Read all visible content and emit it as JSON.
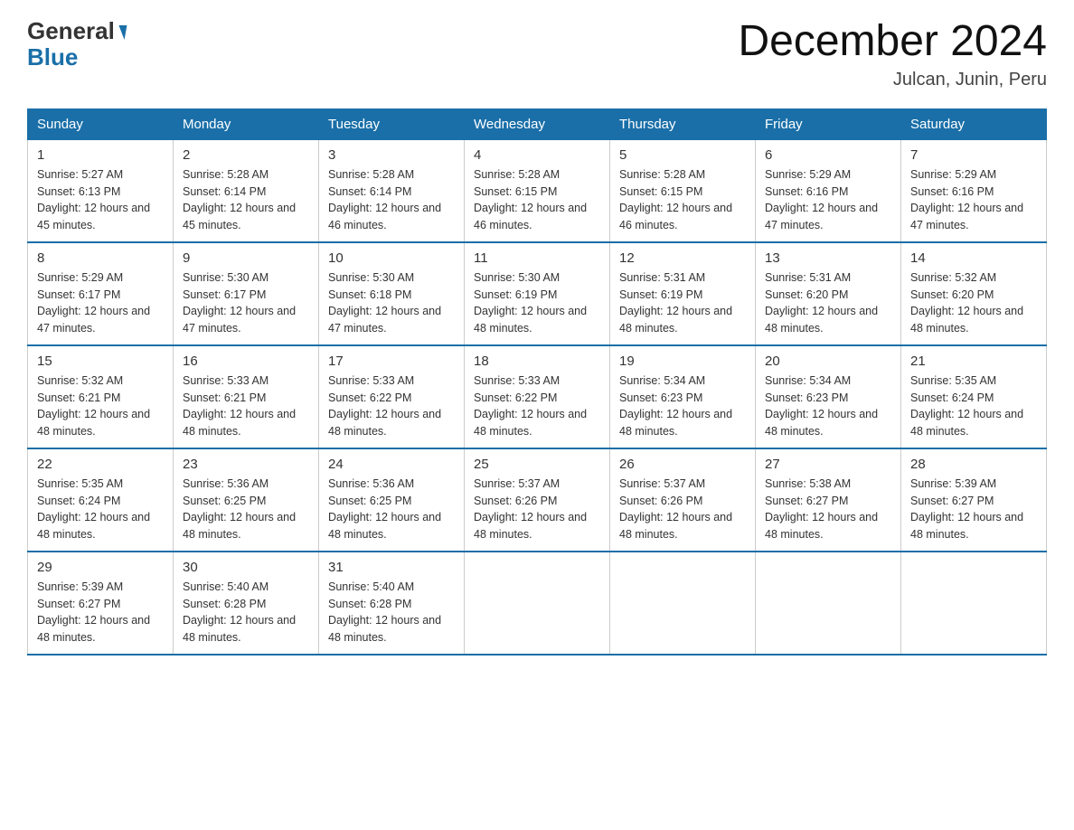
{
  "header": {
    "title": "December 2024",
    "location": "Julcan, Junin, Peru",
    "logo_line1": "General",
    "logo_line2": "Blue"
  },
  "days_of_week": [
    "Sunday",
    "Monday",
    "Tuesday",
    "Wednesday",
    "Thursday",
    "Friday",
    "Saturday"
  ],
  "weeks": [
    [
      {
        "day": "1",
        "sunrise": "5:27 AM",
        "sunset": "6:13 PM",
        "daylight": "12 hours and 45 minutes."
      },
      {
        "day": "2",
        "sunrise": "5:28 AM",
        "sunset": "6:14 PM",
        "daylight": "12 hours and 45 minutes."
      },
      {
        "day": "3",
        "sunrise": "5:28 AM",
        "sunset": "6:14 PM",
        "daylight": "12 hours and 46 minutes."
      },
      {
        "day": "4",
        "sunrise": "5:28 AM",
        "sunset": "6:15 PM",
        "daylight": "12 hours and 46 minutes."
      },
      {
        "day": "5",
        "sunrise": "5:28 AM",
        "sunset": "6:15 PM",
        "daylight": "12 hours and 46 minutes."
      },
      {
        "day": "6",
        "sunrise": "5:29 AM",
        "sunset": "6:16 PM",
        "daylight": "12 hours and 47 minutes."
      },
      {
        "day": "7",
        "sunrise": "5:29 AM",
        "sunset": "6:16 PM",
        "daylight": "12 hours and 47 minutes."
      }
    ],
    [
      {
        "day": "8",
        "sunrise": "5:29 AM",
        "sunset": "6:17 PM",
        "daylight": "12 hours and 47 minutes."
      },
      {
        "day": "9",
        "sunrise": "5:30 AM",
        "sunset": "6:17 PM",
        "daylight": "12 hours and 47 minutes."
      },
      {
        "day": "10",
        "sunrise": "5:30 AM",
        "sunset": "6:18 PM",
        "daylight": "12 hours and 47 minutes."
      },
      {
        "day": "11",
        "sunrise": "5:30 AM",
        "sunset": "6:19 PM",
        "daylight": "12 hours and 48 minutes."
      },
      {
        "day": "12",
        "sunrise": "5:31 AM",
        "sunset": "6:19 PM",
        "daylight": "12 hours and 48 minutes."
      },
      {
        "day": "13",
        "sunrise": "5:31 AM",
        "sunset": "6:20 PM",
        "daylight": "12 hours and 48 minutes."
      },
      {
        "day": "14",
        "sunrise": "5:32 AM",
        "sunset": "6:20 PM",
        "daylight": "12 hours and 48 minutes."
      }
    ],
    [
      {
        "day": "15",
        "sunrise": "5:32 AM",
        "sunset": "6:21 PM",
        "daylight": "12 hours and 48 minutes."
      },
      {
        "day": "16",
        "sunrise": "5:33 AM",
        "sunset": "6:21 PM",
        "daylight": "12 hours and 48 minutes."
      },
      {
        "day": "17",
        "sunrise": "5:33 AM",
        "sunset": "6:22 PM",
        "daylight": "12 hours and 48 minutes."
      },
      {
        "day": "18",
        "sunrise": "5:33 AM",
        "sunset": "6:22 PM",
        "daylight": "12 hours and 48 minutes."
      },
      {
        "day": "19",
        "sunrise": "5:34 AM",
        "sunset": "6:23 PM",
        "daylight": "12 hours and 48 minutes."
      },
      {
        "day": "20",
        "sunrise": "5:34 AM",
        "sunset": "6:23 PM",
        "daylight": "12 hours and 48 minutes."
      },
      {
        "day": "21",
        "sunrise": "5:35 AM",
        "sunset": "6:24 PM",
        "daylight": "12 hours and 48 minutes."
      }
    ],
    [
      {
        "day": "22",
        "sunrise": "5:35 AM",
        "sunset": "6:24 PM",
        "daylight": "12 hours and 48 minutes."
      },
      {
        "day": "23",
        "sunrise": "5:36 AM",
        "sunset": "6:25 PM",
        "daylight": "12 hours and 48 minutes."
      },
      {
        "day": "24",
        "sunrise": "5:36 AM",
        "sunset": "6:25 PM",
        "daylight": "12 hours and 48 minutes."
      },
      {
        "day": "25",
        "sunrise": "5:37 AM",
        "sunset": "6:26 PM",
        "daylight": "12 hours and 48 minutes."
      },
      {
        "day": "26",
        "sunrise": "5:37 AM",
        "sunset": "6:26 PM",
        "daylight": "12 hours and 48 minutes."
      },
      {
        "day": "27",
        "sunrise": "5:38 AM",
        "sunset": "6:27 PM",
        "daylight": "12 hours and 48 minutes."
      },
      {
        "day": "28",
        "sunrise": "5:39 AM",
        "sunset": "6:27 PM",
        "daylight": "12 hours and 48 minutes."
      }
    ],
    [
      {
        "day": "29",
        "sunrise": "5:39 AM",
        "sunset": "6:27 PM",
        "daylight": "12 hours and 48 minutes."
      },
      {
        "day": "30",
        "sunrise": "5:40 AM",
        "sunset": "6:28 PM",
        "daylight": "12 hours and 48 minutes."
      },
      {
        "day": "31",
        "sunrise": "5:40 AM",
        "sunset": "6:28 PM",
        "daylight": "12 hours and 48 minutes."
      },
      null,
      null,
      null,
      null
    ]
  ]
}
